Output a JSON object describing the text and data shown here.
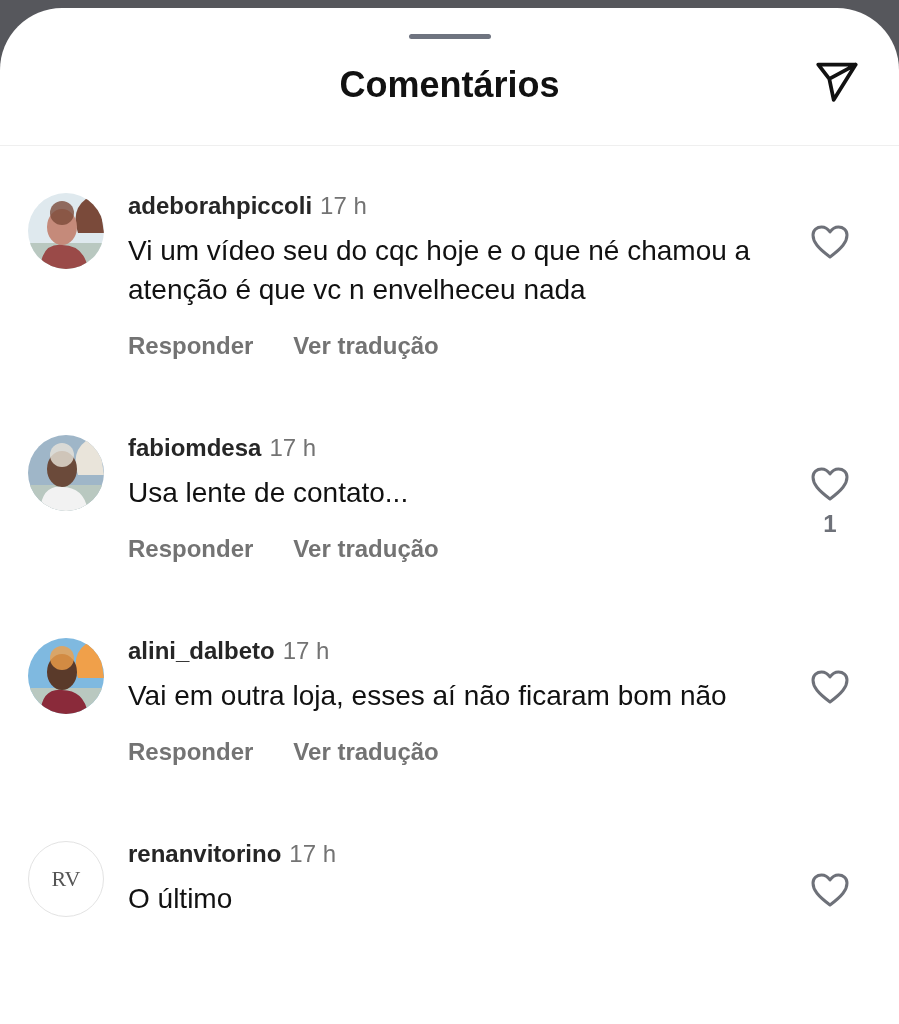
{
  "header": {
    "title": "Comentários"
  },
  "comments": [
    {
      "username": "adeborahpiccoli",
      "time": "17 h",
      "text": "Vi um vídeo seu do cqc hoje e o que né chamou a atenção é que vc n envelheceu nada",
      "actions": [
        "Responder",
        "Ver tradução"
      ],
      "liked": false
    },
    {
      "username": "fabiomdesa",
      "time": "17 h",
      "text": "Usa lente de contato...",
      "actions": [
        "Responder",
        "Ver tradução"
      ],
      "liked": false,
      "like_count": "1"
    },
    {
      "username": "alini_dalbeto",
      "time": "17 h",
      "text": "Vai em outra loja, esses aí não ficaram bom não",
      "actions": [
        "Responder",
        "Ver tradução"
      ],
      "liked": false
    },
    {
      "avatar": {
        "kind": "monogram",
        "text": "RV"
      },
      "username": "renanvitorino",
      "time": "17 h",
      "text": "O último",
      "liked": false
    }
  ]
}
